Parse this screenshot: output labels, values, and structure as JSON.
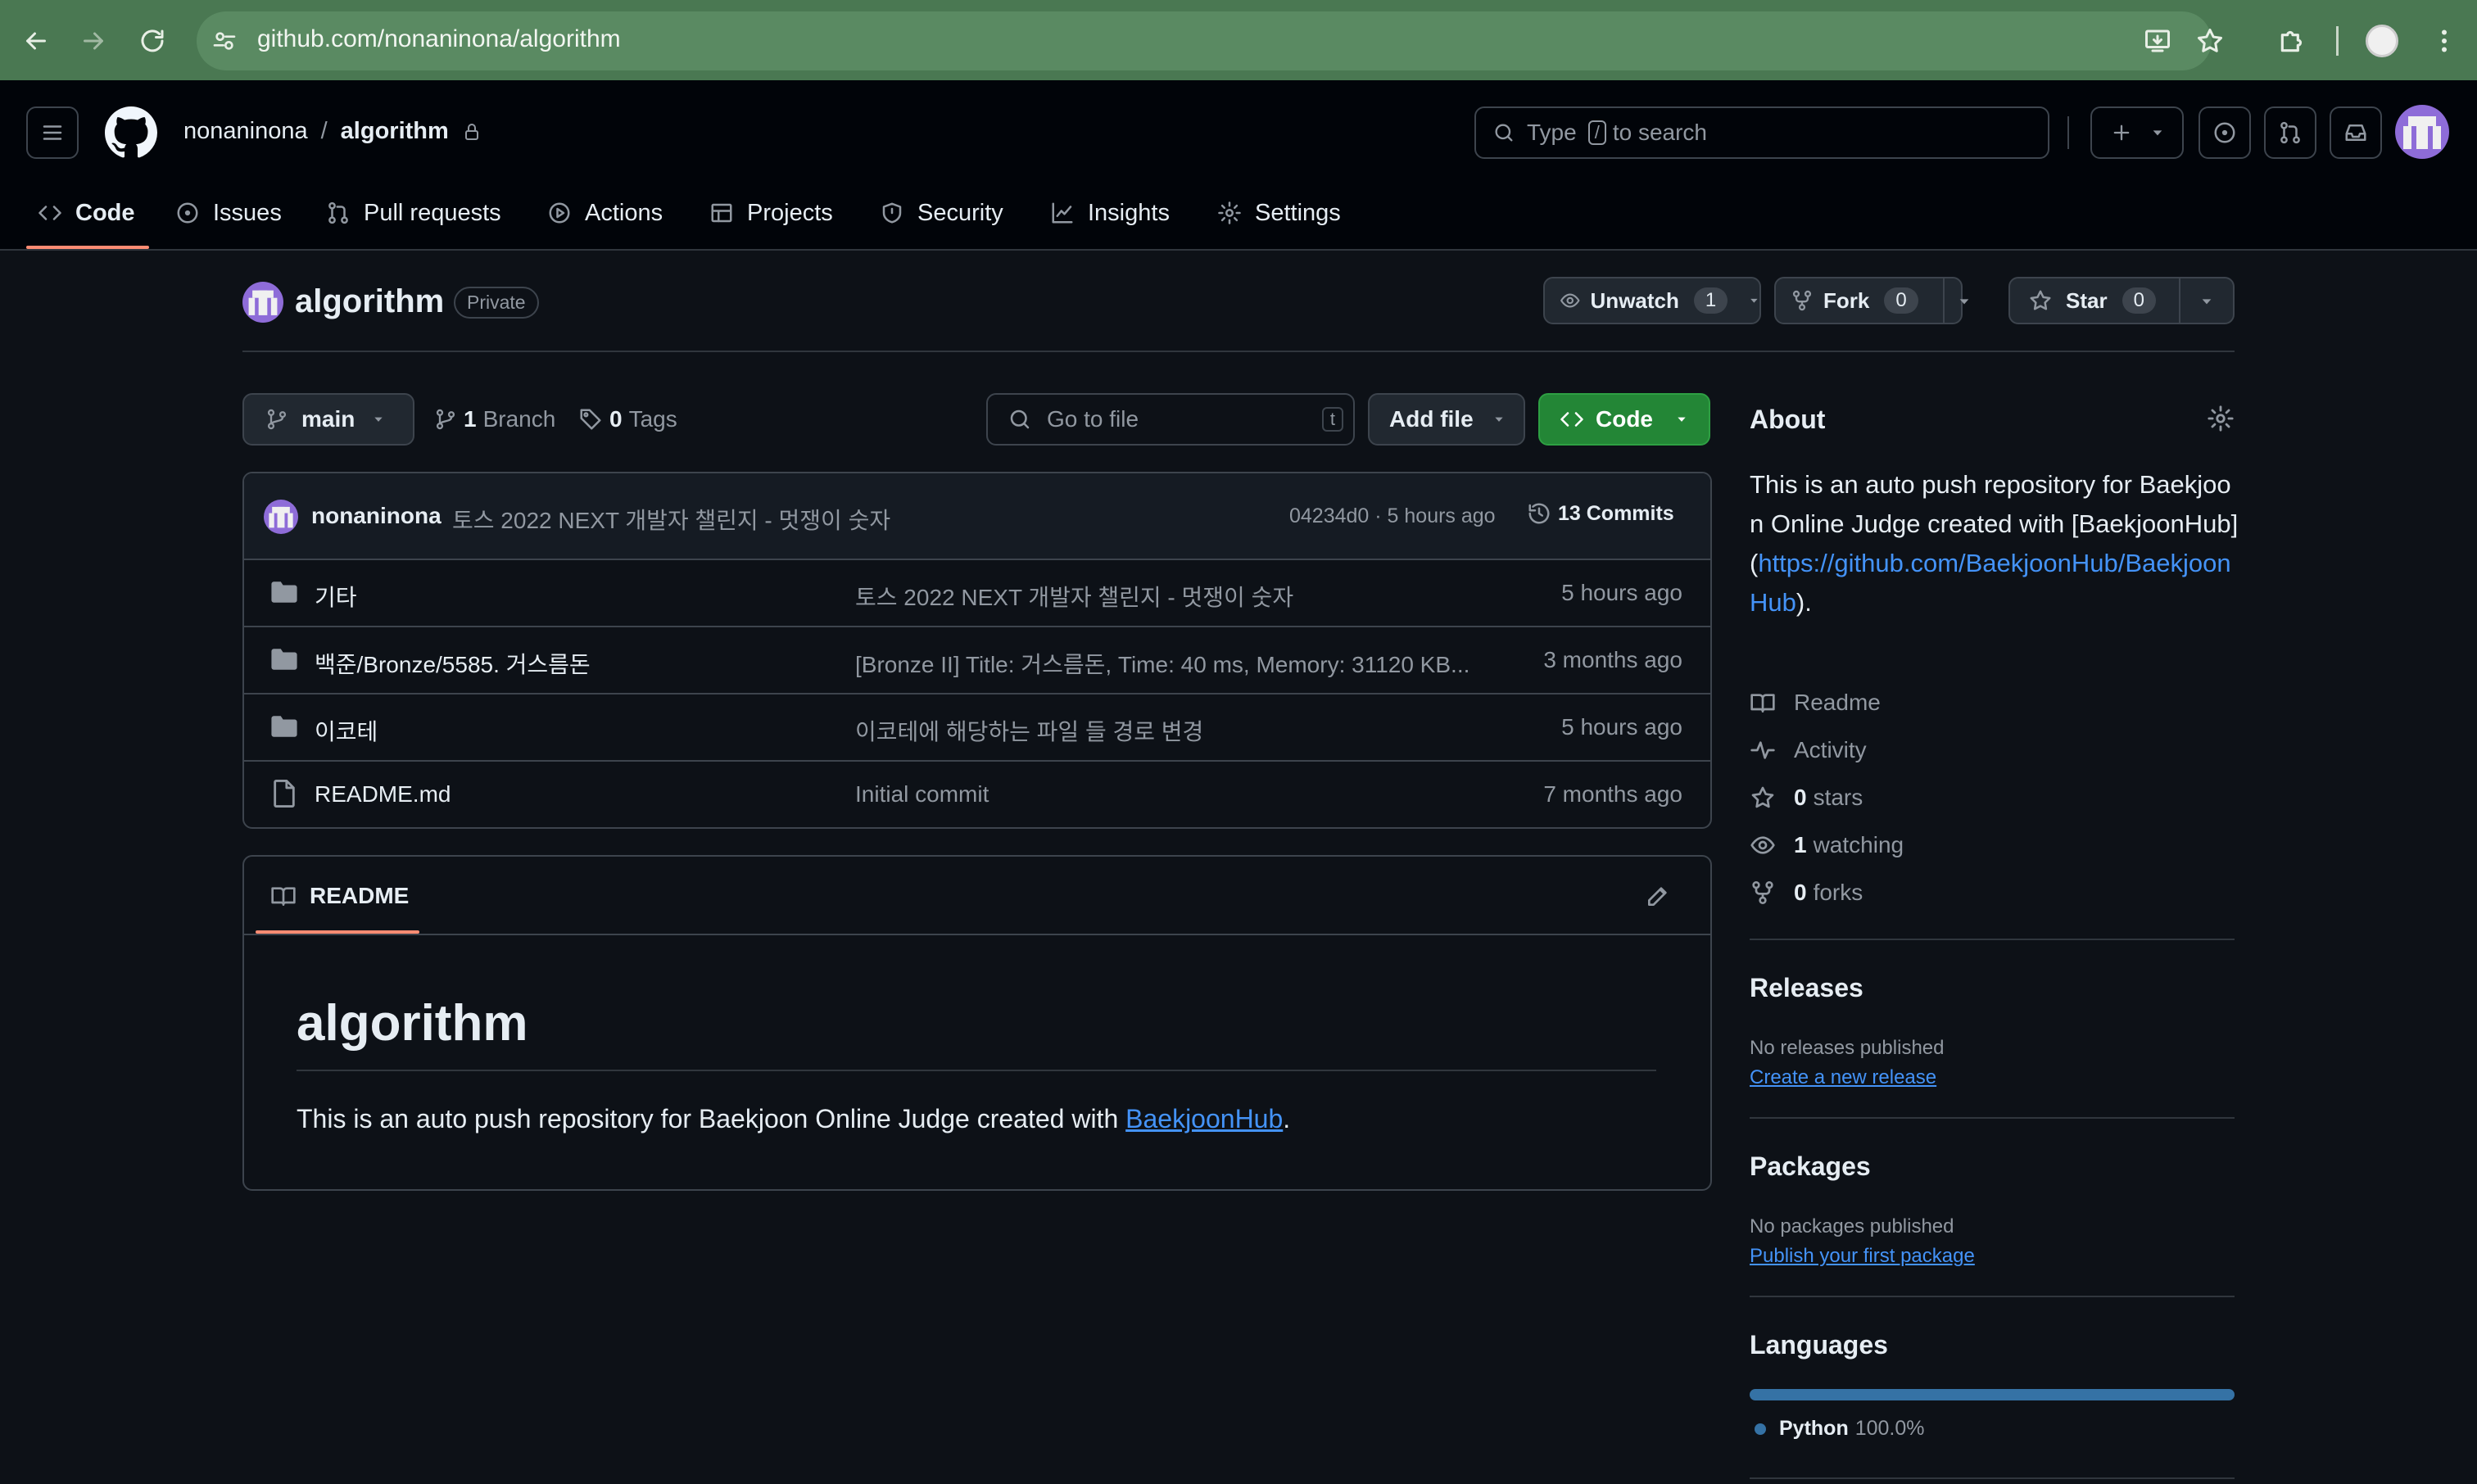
{
  "browser": {
    "url": "github.com/nonaninona/algorithm",
    "colors": {
      "frame": "#4a7852",
      "url_box": "#5a8a62"
    }
  },
  "header": {
    "owner": "nonaninona",
    "separator": "/",
    "repo": "algorithm",
    "search_prefix": "Type",
    "search_key": "/",
    "search_suffix": "to search"
  },
  "nav": {
    "tabs": [
      {
        "label": "Code",
        "icon": "code-icon"
      },
      {
        "label": "Issues",
        "icon": "issue-icon"
      },
      {
        "label": "Pull requests",
        "icon": "pull-request-icon"
      },
      {
        "label": "Actions",
        "icon": "play-icon"
      },
      {
        "label": "Projects",
        "icon": "table-icon"
      },
      {
        "label": "Security",
        "icon": "shield-icon"
      },
      {
        "label": "Insights",
        "icon": "graph-icon"
      },
      {
        "label": "Settings",
        "icon": "gear-icon"
      }
    ],
    "active": "Code"
  },
  "repo": {
    "title": "algorithm",
    "visibility": "Private",
    "unwatch_label": "Unwatch",
    "unwatch_count": "1",
    "fork_label": "Fork",
    "fork_count": "0",
    "star_label": "Star",
    "star_count": "0"
  },
  "toolbar": {
    "branch": "main",
    "branch_count": "1",
    "branch_label": "Branch",
    "tag_count": "0",
    "tag_label": "Tags",
    "goto_placeholder": "Go to file",
    "goto_key": "t",
    "add_file": "Add file",
    "code": "Code"
  },
  "commit": {
    "author": "nonaninona",
    "message": "토스 2022 NEXT 개발자 챌린지 - 멋쟁이 숫자",
    "hash_time": "04234d0 · 5 hours ago",
    "commits": "13 Commits"
  },
  "files": [
    {
      "type": "folder",
      "name": "기타",
      "message": "토스 2022 NEXT 개발자 챌린지 - 멋쟁이 숫자",
      "time": "5 hours ago"
    },
    {
      "type": "folder",
      "name": "백준/Bronze/5585. 거스름돈",
      "message": "[Bronze II] Title: 거스름돈, Time: 40 ms, Memory: 31120 KB...",
      "time": "3 months ago"
    },
    {
      "type": "folder",
      "name": "이코테",
      "message": "이코테에 해당하는 파일 들 경로 변경",
      "time": "5 hours ago"
    },
    {
      "type": "file",
      "name": "README.md",
      "message": "Initial commit",
      "time": "7 months ago"
    }
  ],
  "readme": {
    "tab": "README",
    "heading": "algorithm",
    "text_before": "This is an auto push repository for Baekjoon Online Judge created with",
    "link": "BaekjoonHub",
    "text_after": "."
  },
  "about": {
    "title": "About",
    "description": "This is an auto push repository for Baekjoon Online Judge created with [BaekjoonHub](",
    "url": "https://github.com/BaekjoonHub/BaekjoonHub",
    "description_end": ").",
    "readme": "Readme",
    "activity": "Activity",
    "stars_count": "0",
    "stars_label": "stars",
    "watching_count": "1",
    "watching_label": "watching",
    "forks_count": "0",
    "forks_label": "forks"
  },
  "releases": {
    "title": "Releases",
    "empty": "No releases published",
    "link": "Create a new release"
  },
  "packages": {
    "title": "Packages",
    "empty": "No packages published",
    "link": "Publish your first package"
  },
  "languages": {
    "title": "Languages",
    "items": [
      {
        "name": "Python",
        "percent": "100.0%",
        "fraction": 1.0,
        "color": "#3572A5"
      }
    ]
  },
  "colors": {
    "accent_green": "#238636",
    "active_underline": "#fd8c73",
    "link": "#4493f8"
  }
}
